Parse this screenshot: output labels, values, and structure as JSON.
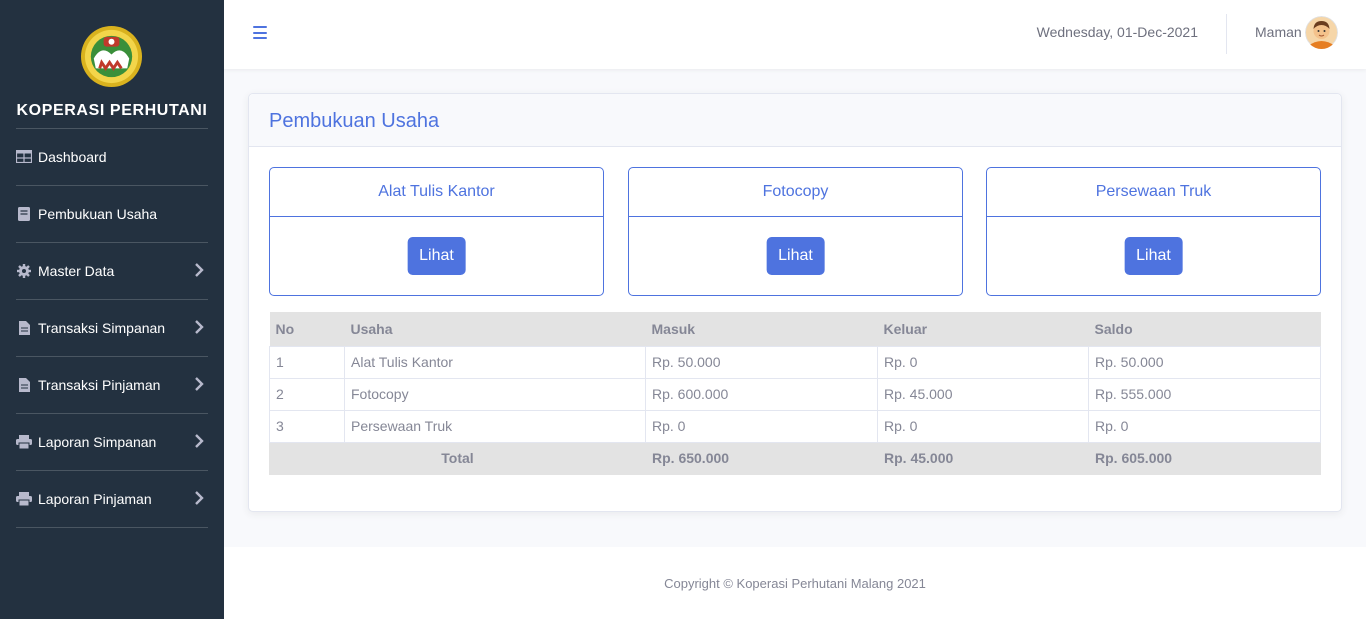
{
  "sidebar": {
    "brand": "KOPERASI PERHUTANI",
    "logo_icon": "koperasi-logo-icon",
    "items": [
      {
        "label": "Dashboard",
        "icon": "table-icon",
        "has_chevron": false
      },
      {
        "label": "Pembukuan Usaha",
        "icon": "book-icon",
        "has_chevron": false
      },
      {
        "label": "Master Data",
        "icon": "gear-icon",
        "has_chevron": true
      },
      {
        "label": "Transaksi Simpanan",
        "icon": "file-icon",
        "has_chevron": true
      },
      {
        "label": "Transaksi Pinjaman",
        "icon": "file-icon",
        "has_chevron": true
      },
      {
        "label": "Laporan Simpanan",
        "icon": "printer-icon",
        "has_chevron": true
      },
      {
        "label": "Laporan Pinjaman",
        "icon": "printer-icon",
        "has_chevron": true
      }
    ]
  },
  "topbar": {
    "date": "Wednesday, 01-Dec-2021",
    "user": "Maman"
  },
  "page": {
    "title": "Pembukuan Usaha",
    "cards": [
      {
        "title": "Alat Tulis Kantor",
        "button": "Lihat"
      },
      {
        "title": "Fotocopy",
        "button": "Lihat"
      },
      {
        "title": "Persewaan Truk",
        "button": "Lihat"
      }
    ]
  },
  "table": {
    "headers": [
      "No",
      "Usaha",
      "Masuk",
      "Keluar",
      "Saldo"
    ],
    "rows": [
      [
        "1",
        "Alat Tulis Kantor",
        "Rp. 50.000",
        "Rp. 0",
        "Rp. 50.000"
      ],
      [
        "2",
        "Fotocopy",
        "Rp. 600.000",
        "Rp. 45.000",
        "Rp. 555.000"
      ],
      [
        "3",
        "Persewaan Truk",
        "Rp. 0",
        "Rp. 0",
        "Rp. 0"
      ]
    ],
    "total": {
      "label": "Total",
      "masuk": "Rp. 650.000",
      "keluar": "Rp. 45.000",
      "saldo": "Rp. 605.000"
    }
  },
  "footer": {
    "copyright": "Copyright © Koperasi Perhutani Malang 2021"
  },
  "colors": {
    "sidebar_bg": "#233140",
    "primary": "#4e73df",
    "table_header_bg": "#e3e3e3",
    "text_muted": "#858796"
  }
}
